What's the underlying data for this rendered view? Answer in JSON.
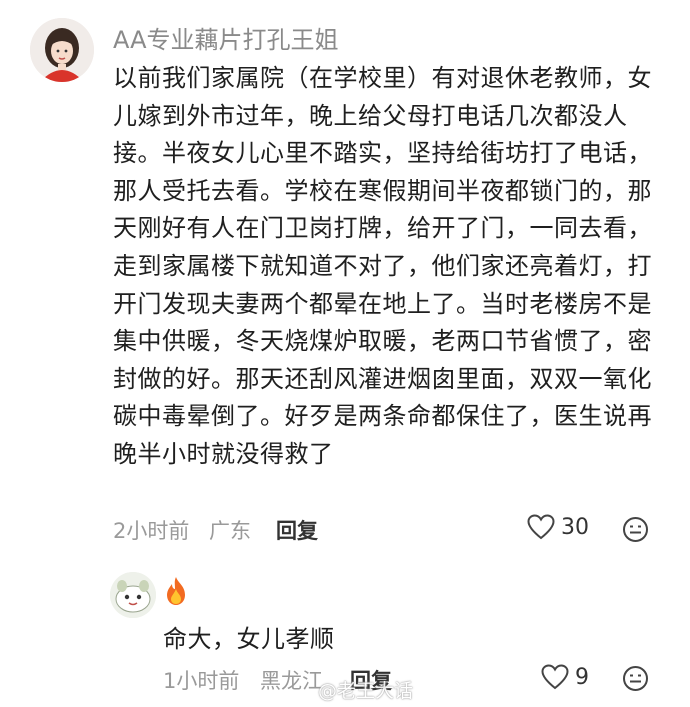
{
  "comment": {
    "username": "AA专业藕片打孔王姐",
    "text": "以前我们家属院（在学校里）有对退休老教师，女儿嫁到外市过年，晚上给父母打电话几次都没人接。半夜女儿心里不踏实，坚持给街坊打了电话，那人受托去看。学校在寒假期间半夜都锁门的，那天刚好有人在门卫岗打牌，给开了门，一同去看，走到家属楼下就知道不对了，他们家还亮着灯，打开门发现夫妻两个都晕在地上了。当时老楼房不是集中供暖，冬天烧煤炉取暖，老两口节省惯了，密封做的好。那天还刮风灌进烟囱里面，双双一氧化碳中毒晕倒了。好歹是两条命都保住了，医生说再晚半小时就没得救了",
    "time": "2小时前",
    "location": "广东",
    "reply_label": "回复",
    "like_count": "30"
  },
  "reply": {
    "emoji": "🔥",
    "text": "命大，女儿孝顺",
    "time": "1小时前",
    "location": "黑龙江",
    "reply_label": "回复",
    "like_count": "9"
  },
  "watermark": "@老王大话",
  "colors": {
    "meta": "#9a9a9a",
    "text": "#1f1f1f",
    "icon": "#444444"
  }
}
